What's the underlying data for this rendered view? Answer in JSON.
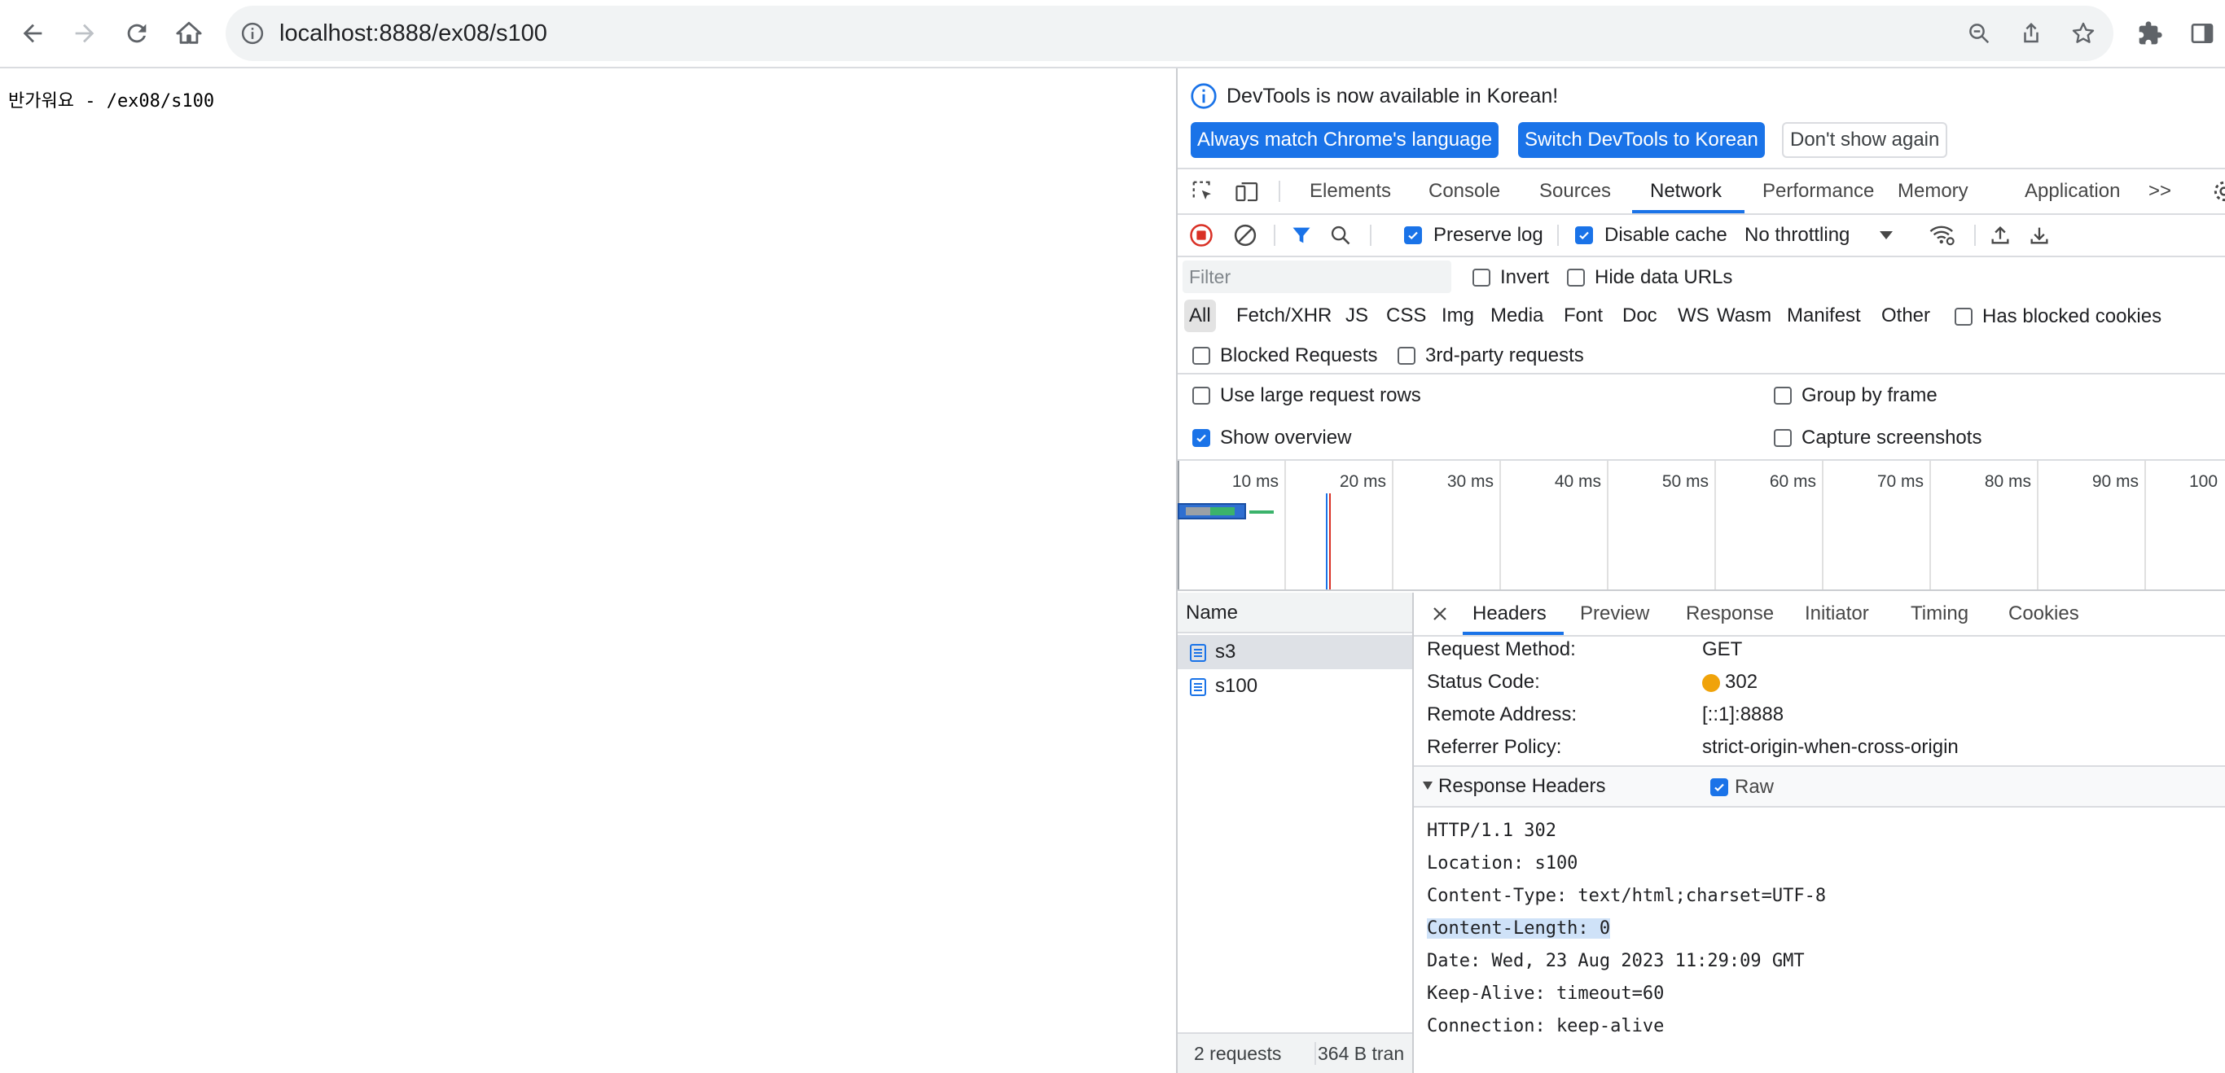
{
  "browser": {
    "url": "localhost:8888/ex08/s100"
  },
  "page": {
    "text": "반가워요 - /ex08/s100"
  },
  "devtools": {
    "infobar": {
      "message": "DevTools is now available in Korean!",
      "btn_match": "Always match Chrome's language",
      "btn_switch": "Switch DevTools to Korean",
      "btn_dismiss": "Don't show again"
    },
    "tabs": [
      {
        "label": "Elements"
      },
      {
        "label": "Console"
      },
      {
        "label": "Sources"
      },
      {
        "label": "Network"
      },
      {
        "label": "Performance"
      },
      {
        "label": "Memory"
      },
      {
        "label": "Application"
      }
    ],
    "more_tabs": ">>",
    "active_tab": "Network",
    "netbar": {
      "preserve_log": "Preserve log",
      "preserve_log_checked": true,
      "disable_cache": "Disable cache",
      "disable_cache_checked": true,
      "throttling": "No throttling"
    },
    "filter": {
      "placeholder": "Filter",
      "invert": "Invert",
      "hide_data_urls": "Hide data URLs"
    },
    "types": [
      "All",
      "Fetch/XHR",
      "JS",
      "CSS",
      "Img",
      "Media",
      "Font",
      "Doc",
      "WS",
      "Wasm",
      "Manifest",
      "Other"
    ],
    "has_blocked_cookies": "Has blocked cookies",
    "blocked_requests": "Blocked Requests",
    "third_party": "3rd-party requests",
    "options": {
      "large_rows": "Use large request rows",
      "group_by_frame": "Group by frame",
      "show_overview": "Show overview",
      "show_overview_checked": true,
      "capture_screenshots": "Capture screenshots"
    },
    "overview_ticks": [
      "10 ms",
      "20 ms",
      "30 ms",
      "40 ms",
      "50 ms",
      "60 ms",
      "70 ms",
      "80 ms",
      "90 ms",
      "100"
    ],
    "requests": {
      "header": "Name",
      "rows": [
        {
          "name": "s3",
          "selected": true
        },
        {
          "name": "s100",
          "selected": false
        }
      ],
      "status_count": "2 requests",
      "status_transfer": "364 B tran"
    },
    "detail": {
      "tabs": [
        "Headers",
        "Preview",
        "Response",
        "Initiator",
        "Timing",
        "Cookies"
      ],
      "active": "Headers",
      "general": [
        {
          "key": "Request Method:",
          "value": "GET"
        },
        {
          "key": "Status Code:",
          "value": "302"
        },
        {
          "key": "Remote Address:",
          "value": "[::1]:8888"
        },
        {
          "key": "Referrer Policy:",
          "value": "strict-origin-when-cross-origin"
        }
      ],
      "status_color": "#f0a30a",
      "response_headers_title": "Response Headers",
      "raw_label": "Raw",
      "raw_checked": true,
      "raw_lines": [
        "HTTP/1.1 302",
        "Location: s100",
        "Content-Type: text/html;charset=UTF-8",
        "Content-Length: 0",
        "Date: Wed, 23 Aug 2023 11:29:09 GMT",
        "Keep-Alive: timeout=60",
        "Connection: keep-alive"
      ],
      "highlighted_line": 3
    }
  },
  "colors": {
    "accent": "#1a73e8",
    "record_red": "#d93025"
  }
}
